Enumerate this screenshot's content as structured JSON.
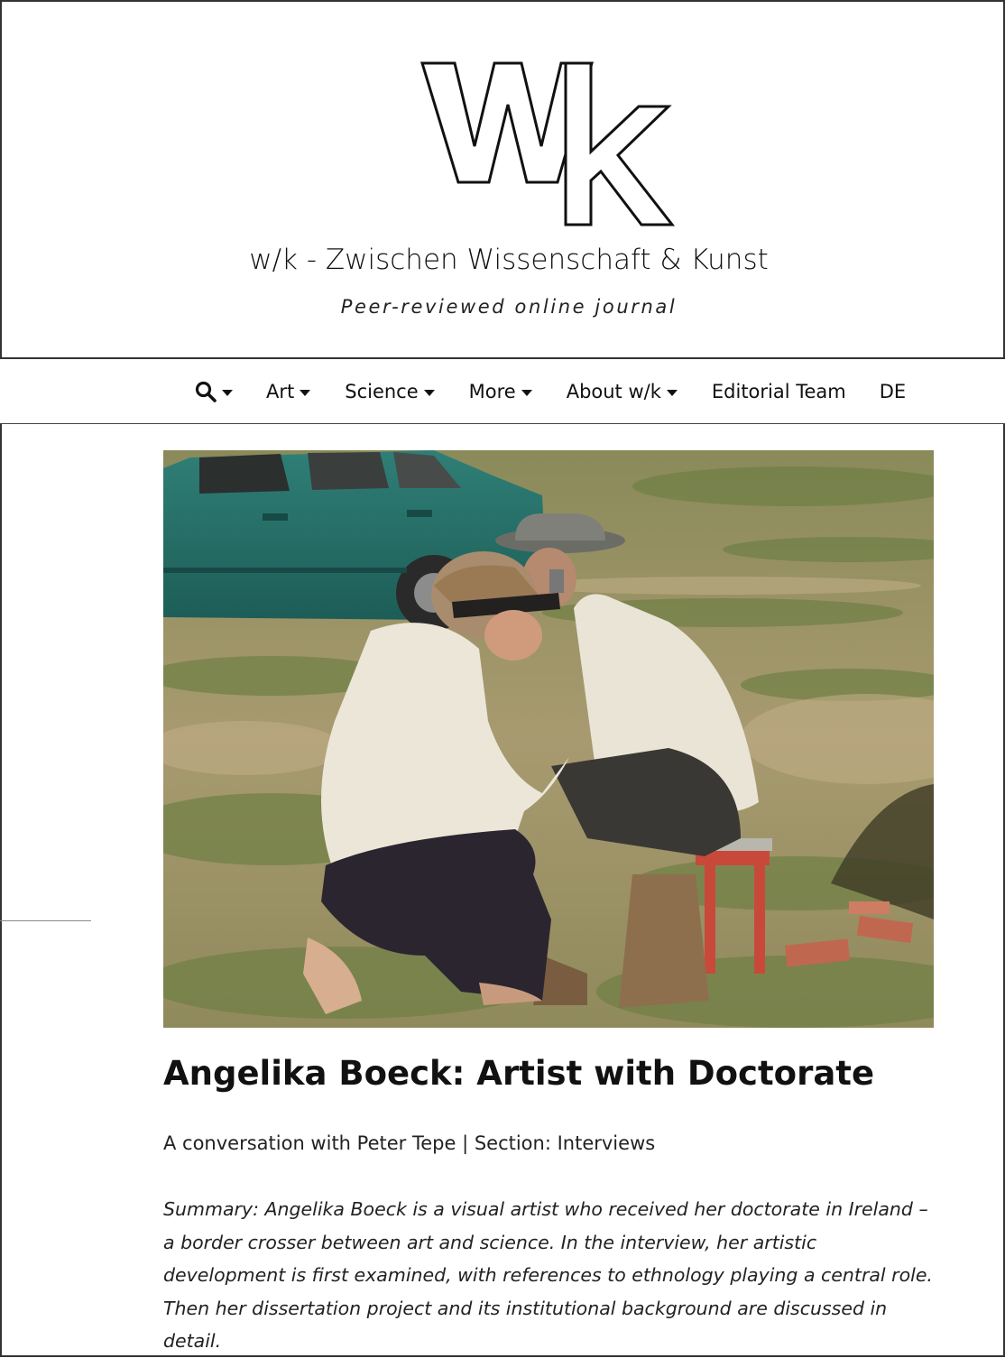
{
  "logo": {
    "text": "Wk",
    "alt": "w/k logo"
  },
  "site": {
    "title": "w/k - Zwischen Wissenschaft & Kunst",
    "tagline": "Peer-reviewed online journal"
  },
  "nav": {
    "items": [
      {
        "label": "Art"
      },
      {
        "label": "Science"
      },
      {
        "label": "More"
      },
      {
        "label": "About w/k"
      },
      {
        "label": "Editorial Team"
      },
      {
        "label": "DE"
      }
    ]
  },
  "icons": {
    "search": "search-icon",
    "dropdown": "chevron-down-icon"
  },
  "article": {
    "title": "Angelika Boeck: Artist with Doctorate",
    "byline": "A conversation with Peter Tepe | Section: Interviews",
    "summary": "Summary: Angelika Boeck is a visual artist who received her doctorate in Ireland – a border crosser between art and science. In the interview, her artistic development is first examined, with references to ethnology playing a central role. Then her dissertation project and its institutional background are discussed in detail."
  },
  "colors": {
    "text": "#111111",
    "border": "#333333",
    "background": "#ffffff"
  }
}
